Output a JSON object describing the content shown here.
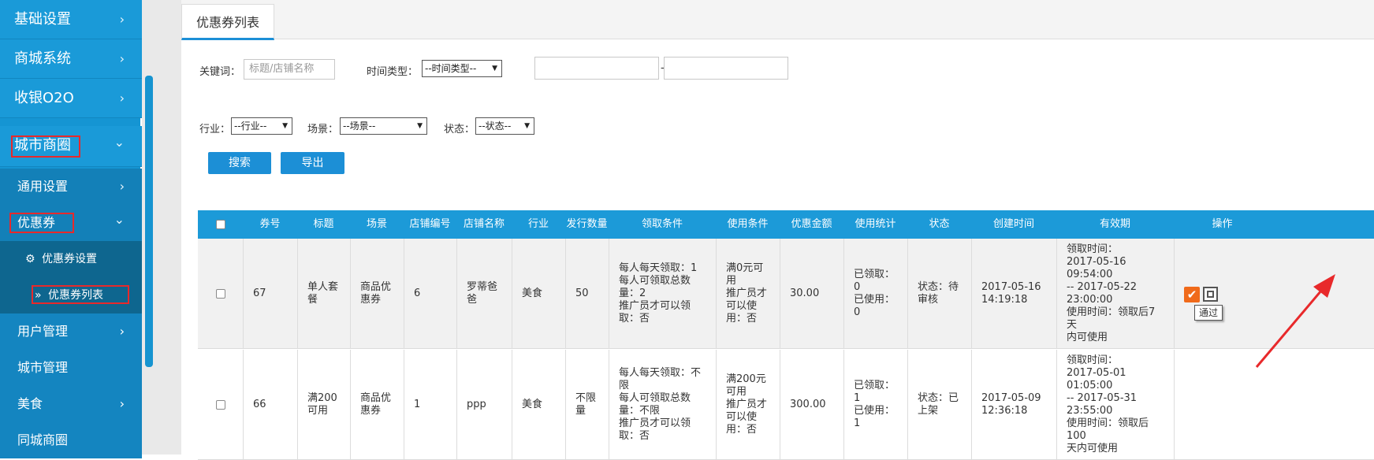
{
  "sidebar": {
    "items": [
      {
        "label": "基础设置"
      },
      {
        "label": "商城系统"
      },
      {
        "label": "收银O2O"
      },
      {
        "label": "城市商圈"
      }
    ],
    "sub": [
      {
        "label": "通用设置"
      },
      {
        "label": "优惠券"
      }
    ],
    "sub2": [
      {
        "label": "优惠券设置"
      },
      {
        "label": "优惠券列表"
      }
    ],
    "rest": [
      {
        "label": "用户管理"
      },
      {
        "label": "城市管理"
      },
      {
        "label": "美食"
      },
      {
        "label": "同城商圈"
      }
    ],
    "chevron_right": "›",
    "chevron_down": "⌄"
  },
  "tabs": {
    "active": "优惠券列表"
  },
  "filters": {
    "keyword_label": "关键词：",
    "keyword_placeholder": "标题/店铺名称",
    "time_type_label": "时间类型：",
    "time_type_value": "--时间类型--",
    "range_sep": "-",
    "industry_label": "行业：",
    "industry_value": "--行业--",
    "scene_label": "场景：",
    "scene_value": "--场景--",
    "status_label": "状态：",
    "status_value": "--状态--",
    "search_btn": "搜索",
    "export_btn": "导出"
  },
  "table": {
    "headers": [
      "券号",
      "标题",
      "场景",
      "店铺编号",
      "店铺名称",
      "行业",
      "发行数量",
      "领取条件",
      "使用条件",
      "优惠金额",
      "使用统计",
      "状态",
      "创建时间",
      "有效期",
      "操作"
    ],
    "rows": [
      {
        "id": "67",
        "title": "单人套\n餐",
        "scene": "商品优\n惠券",
        "shop_no": "6",
        "shop_name": "罗蒂爸\n爸",
        "industry": "美食",
        "qty": "50",
        "receive": "每人每天领取：1\n每人可领取总数\n量：2\n推广员才可以领\n取：否",
        "use": "满0元可\n用\n推广员才\n可以使\n用：否",
        "amount": "30.00",
        "stats": "已领取：\n0\n已使用：\n0",
        "status": "状态：待\n审核",
        "created": "2017-05-16\n14:19:18",
        "valid": "领取时间：\n2017-05-16 09:54:00\n-- 2017-05-22\n23:00:00\n使用时间：领取后7天\n内可使用",
        "tooltip": "通过"
      },
      {
        "id": "66",
        "title": "满200\n可用",
        "scene": "商品优\n惠券",
        "shop_no": "1",
        "shop_name": "ppp",
        "industry": "美食",
        "qty": "不限\n量",
        "receive": "每人每天领取：不\n限\n每人可领取总数\n量：不限\n推广员才可以领\n取：否",
        "use": "满200元\n可用\n推广员才\n可以使\n用：否",
        "amount": "300.00",
        "stats": "已领取：\n1\n已使用：\n1",
        "status": "状态：已\n上架",
        "created": "2017-05-09\n12:36:18",
        "valid": "领取时间：\n2017-05-01 01:05:00\n-- 2017-05-31\n23:55:00\n使用时间：领取后100\n天内可使用"
      }
    ]
  },
  "colors": {
    "sidebar": "#1595d3",
    "header": "#1c9ad8",
    "accent": "#1c8fd6",
    "highlight": "#e8292b",
    "action": "#f06a1a"
  }
}
